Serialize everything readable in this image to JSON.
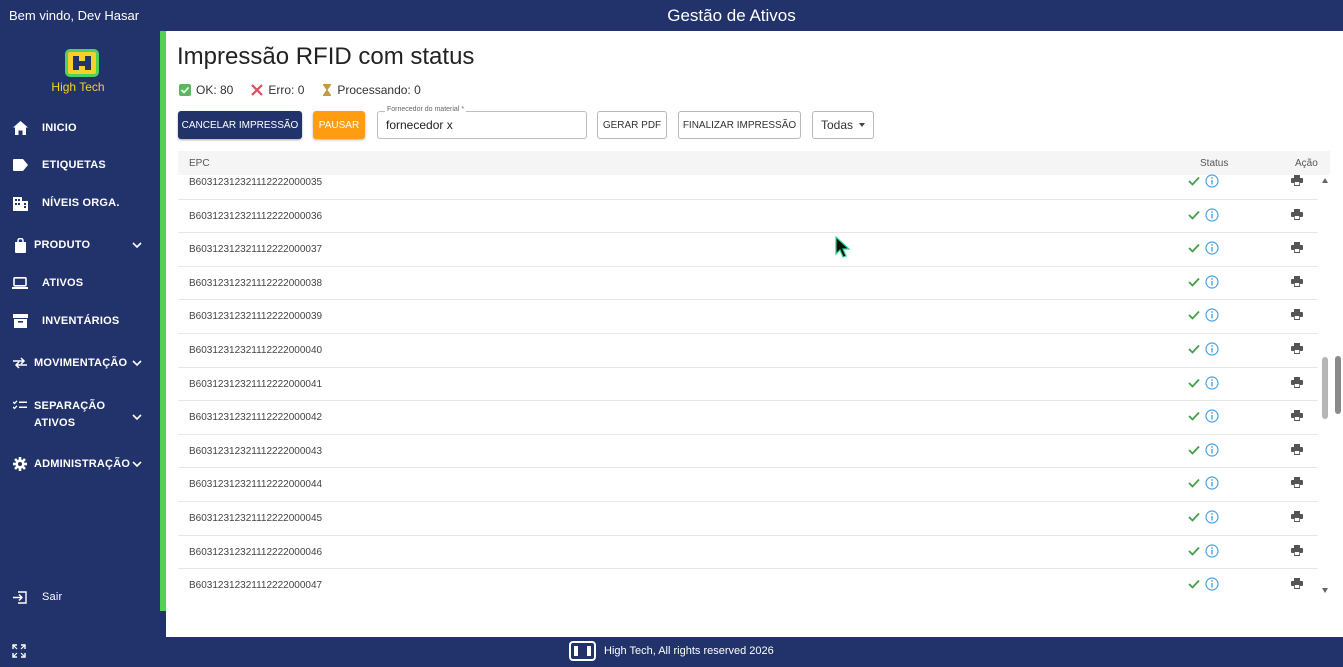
{
  "topbar": {
    "welcome": "Bem vindo, Dev Hasar",
    "app_title": "Gestão de Ativos"
  },
  "logo": {
    "name": "High Tech"
  },
  "sidebar": {
    "items": [
      {
        "label": "INICIO",
        "icon": "home-icon"
      },
      {
        "label": "ETIQUETAS",
        "icon": "label-icon"
      },
      {
        "label": "NÍVEIS ORGA.",
        "icon": "building-icon"
      },
      {
        "label": "PRODUTO",
        "icon": "bag-icon"
      },
      {
        "label": "ATIVOS",
        "icon": "laptop-icon"
      },
      {
        "label": "INVENTÁRIOS",
        "icon": "archive-icon"
      },
      {
        "label": "MOVIMENTAÇÃO",
        "icon": "swap-icon"
      },
      {
        "label_line1": "SEPARAÇÃO",
        "label_line2": "ATIVOS",
        "icon": "checklist-icon"
      },
      {
        "label": "ADMINISTRAÇÃO",
        "icon": "gear-icon"
      }
    ],
    "logout": "Sair"
  },
  "page": {
    "title": "Impressão RFID com status",
    "stats": {
      "ok": "OK: 80",
      "erro": "Erro: 0",
      "processando": "Processando: 0"
    }
  },
  "toolbar": {
    "cancel_label": "CANCELAR IMPRESSÃO",
    "pause_label": "PAUSAR",
    "supplier_label": "Fornecedor do material *",
    "supplier_value": "fornecedor x",
    "pdf_label": "GERAR PDF",
    "finish_label": "FINALIZAR IMPRESSÃO",
    "filter_value": "Todas"
  },
  "table": {
    "headers": {
      "epc": "EPC",
      "status": "Status",
      "acao": "Ação"
    },
    "rows": [
      "B60312312321112222000035",
      "B60312312321112222000036",
      "B60312312321112222000037",
      "B60312312321112222000038",
      "B60312312321112222000039",
      "B60312312321112222000040",
      "B60312312321112222000041",
      "B60312312321112222000042",
      "B60312312321112222000043",
      "B60312312321112222000044",
      "B60312312321112222000045",
      "B60312312321112222000046",
      "B60312312321112222000047"
    ],
    "row_status": "ok"
  },
  "footer": {
    "text": "High Tech, All rights reserved 2026"
  },
  "colors": {
    "brand": "#22336b",
    "accent_green": "#4fd15b",
    "pause": "#ff9d12",
    "check": "#43a047",
    "info": "#4aa3df"
  }
}
